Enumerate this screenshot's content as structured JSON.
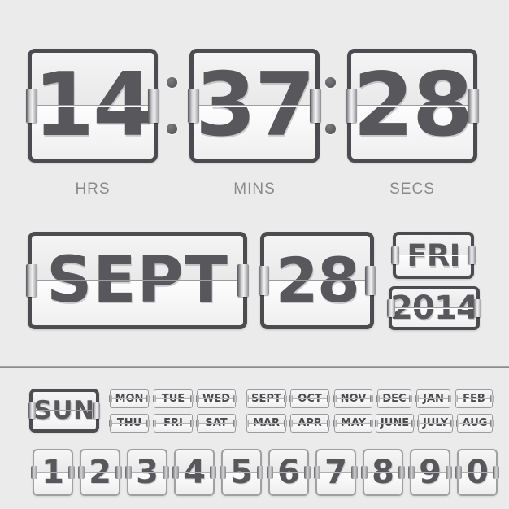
{
  "theme": {
    "background": "#ecebeb",
    "panel_border": "#4b4b50",
    "glyph_color": "#58585c",
    "label_color": "#8a8a8c",
    "divider_color": "#7e7e82"
  },
  "clock": {
    "hours": {
      "value": "14",
      "label": "HRS"
    },
    "minutes": {
      "value": "37",
      "label": "MINS"
    },
    "seconds": {
      "value": "28",
      "label": "SECS"
    },
    "separator": ":"
  },
  "date": {
    "month": "SEPT",
    "day": "28",
    "weekday": "FRI",
    "year": "2014"
  },
  "kit": {
    "featured_weekday": "SUN",
    "weekdays": [
      "MON",
      "TUE",
      "WED",
      "THU",
      "FRI",
      "SAT"
    ],
    "weekdays_row1": [
      "MON",
      "TUE",
      "WED"
    ],
    "weekdays_row2": [
      "THU",
      "FRI",
      "SAT"
    ],
    "months_row1": [
      "SEPT",
      "OCT",
      "NOV",
      "DEC",
      "JAN",
      "FEB"
    ],
    "months_row2": [
      "MAR",
      "APR",
      "MAY",
      "JUNE",
      "JULY",
      "AUG"
    ],
    "digits": [
      "1",
      "2",
      "3",
      "4",
      "5",
      "6",
      "7",
      "8",
      "9",
      "0"
    ]
  }
}
